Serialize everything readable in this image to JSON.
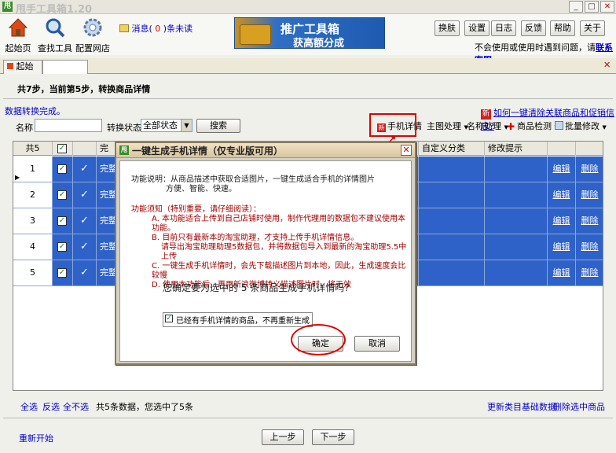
{
  "window": {
    "title": "甩手工具箱1.20",
    "app_icon_text": "甩"
  },
  "toolbar": {
    "tools": [
      {
        "label": "起始页",
        "icon": "home-icon"
      },
      {
        "label": "查找工具",
        "icon": "magnifier-icon"
      },
      {
        "label": "配置网店",
        "icon": "gear-icon"
      }
    ],
    "message_prefix": "消息(",
    "message_count": "0",
    "message_suffix": ")条未读",
    "banner_line1": "推广工具箱",
    "banner_line2": "获高额分成",
    "buttons": [
      "换肤",
      "设置",
      "日志",
      "反馈",
      "帮助",
      "关于"
    ],
    "notice_text": "不会使用或使用时遇到问题，请",
    "notice_link": "联系客服"
  },
  "tabs": {
    "home_label": "起始页"
  },
  "content": {
    "step_text": "共7步，当前第5步，转换商品详情",
    "done_text": "数据转换完成。",
    "howto_icon": "新",
    "howto_text": "如何一键清除关联商品和促销信息?",
    "filter": {
      "name_label": "名称",
      "name_value": "",
      "status_label": "转换状态",
      "status_value": "全部状态",
      "search_label": "搜索"
    },
    "actions": {
      "mobile_icon": "新",
      "mobile_label": "手机详情",
      "main_image_label": "主图处理",
      "name_label": "名称处理",
      "check_label": "商品检测",
      "batch_label": "批量修改"
    }
  },
  "grid": {
    "headers": {
      "count": "共5",
      "complete": "完",
      "custom_category": "自定义分类",
      "modify_tip": "修改提示"
    },
    "rows": [
      {
        "num": "1",
        "status": "完整",
        "edit": "编辑",
        "delete": "删除"
      },
      {
        "num": "2",
        "status": "完整",
        "edit": "编辑",
        "delete": "删除"
      },
      {
        "num": "3",
        "status": "完整",
        "edit": "编辑",
        "delete": "删除"
      },
      {
        "num": "4",
        "status": "完整",
        "edit": "编辑",
        "delete": "删除"
      },
      {
        "num": "5",
        "status": "完整",
        "edit": "编辑",
        "delete": "删除"
      }
    ]
  },
  "bottom": {
    "select_all": "全选",
    "invert": "反选",
    "select_none": "全不选",
    "summary": "共5条数据，您选中了5条",
    "refresh_category": "更新类目基础数据",
    "delete_selected": "删除选中商品",
    "restart": "重新开始",
    "prev": "上一步",
    "next": "下一步"
  },
  "dialog": {
    "icon": "甩",
    "title": "一键生成手机详情（仅专业版可用）",
    "desc_line1": "功能说明：从商品描述中获取合适图片，一键生成适合手机的详情图片",
    "desc_line2": "方便、智能、快速。",
    "notice_title": "功能须知（特别重要，请仔细阅读）：",
    "notice_items": [
      "A. 本功能适合上传到自己店铺时使用，制作代理用的数据包不建议使用本功能。",
      "B. 目前只有最新本的淘宝助理，才支持上传手机详情信息。",
      "请导出淘宝助理助理5数据包，并将数据包导入到最新的淘宝助理5.5中上传",
      "C. 一键生成手机详情时，会先下载描述图片到本地，因此，生成速度会比较慢",
      "D. 使用本功能后，再用新浪微博转义描述图片时，将无效"
    ],
    "confirm_text": "您确定要为选中的 5 条商品生成手机详情吗?",
    "checkbox_label": "已经有手机详情的商品，不再重新生成",
    "ok_label": "确定",
    "cancel_label": "取消"
  }
}
